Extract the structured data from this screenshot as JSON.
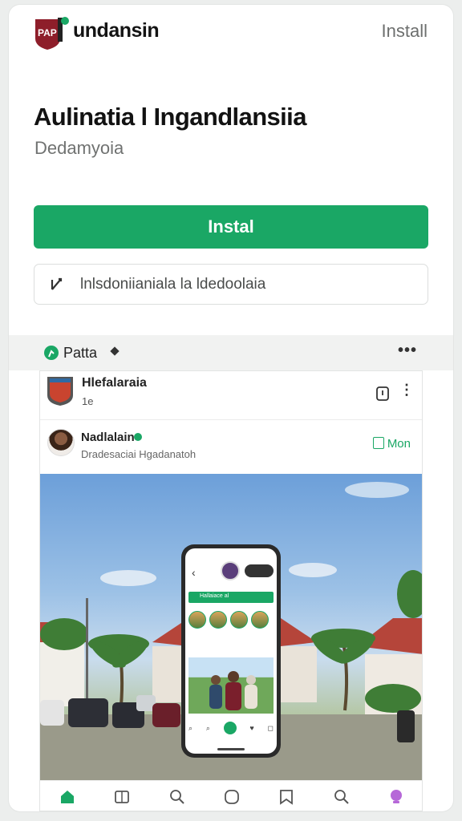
{
  "header": {
    "brand": "undansin",
    "install_link": "Install"
  },
  "app": {
    "title": "Aulinatia l Ingandlansiia",
    "subtitle": "Dedamyoia",
    "install_button": "Instal",
    "secondary_action": "lnlsdoniianiala la ldedoolaia"
  },
  "section": {
    "label": "Patta"
  },
  "card": {
    "title": "Hlefalaraia",
    "meta": "1e",
    "author_name": "Nadlalain",
    "author_sub": "Dradesaciai Hgadanatoh",
    "more_label": "Mon"
  },
  "phone_preview": {
    "banner_text": "Hallaiace al"
  },
  "bottom_nav": {
    "items": [
      "home-icon",
      "book-icon",
      "search-icon",
      "chat-icon",
      "bookmark-icon",
      "search-icon",
      "profile-icon"
    ]
  },
  "colors": {
    "accent": "#1aa765",
    "brand_red": "#8e1e2a"
  }
}
